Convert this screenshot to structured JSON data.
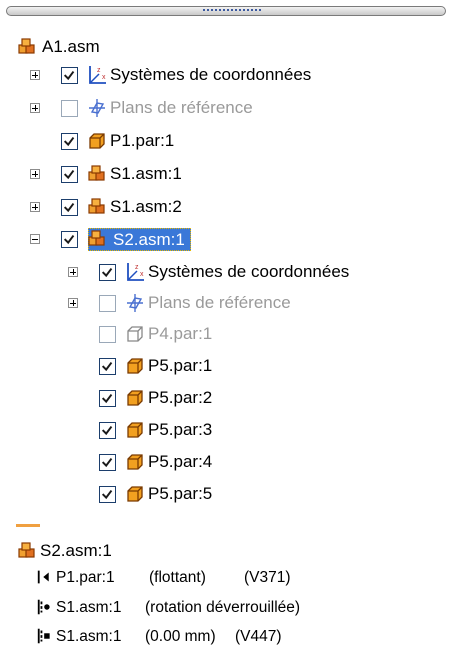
{
  "tree": {
    "root": {
      "label": "A1.asm",
      "icon": "assembly-icon"
    },
    "items": [
      {
        "label": "Systèmes de coordonnées",
        "expander": "plus",
        "checked": true,
        "icon": "coordinate-systems-icon"
      },
      {
        "label": "Plans de référence",
        "expander": "plus",
        "checked": false,
        "icon": "reference-planes-icon"
      },
      {
        "label": "P1.par:1",
        "expander": "none",
        "checked": true,
        "icon": "part-icon"
      },
      {
        "label": "S1.asm:1",
        "expander": "plus",
        "checked": true,
        "icon": "assembly-icon"
      },
      {
        "label": "S1.asm:2",
        "expander": "plus",
        "checked": true,
        "icon": "assembly-icon"
      },
      {
        "label": "S2.asm:1",
        "expander": "minus",
        "checked": true,
        "icon": "assembly-icon",
        "selected": true
      },
      {
        "label": "Systèmes de coordonnées",
        "expander": "plus",
        "checked": true,
        "icon": "coordinate-systems-icon"
      },
      {
        "label": "Plans de référence",
        "expander": "plus",
        "checked": false,
        "icon": "reference-planes-icon"
      },
      {
        "label": "P4.par:1",
        "expander": "none",
        "checked": false,
        "icon": "part-icon"
      },
      {
        "label": "P5.par:1",
        "expander": "none",
        "checked": true,
        "icon": "part-icon"
      },
      {
        "label": "P5.par:2",
        "expander": "none",
        "checked": true,
        "icon": "part-icon"
      },
      {
        "label": "P5.par:3",
        "expander": "none",
        "checked": true,
        "icon": "part-icon"
      },
      {
        "label": "P5.par:4",
        "expander": "none",
        "checked": true,
        "icon": "part-icon"
      },
      {
        "label": "P5.par:5",
        "expander": "none",
        "checked": true,
        "icon": "part-icon"
      }
    ]
  },
  "relations": {
    "title": "S2.asm:1",
    "items": [
      {
        "part": "P1.par:1",
        "detail": "(flottant)",
        "code": "(V371)",
        "icon": "float-relation-icon"
      },
      {
        "part": "S1.asm:1",
        "detail": "(rotation déverrouillée)",
        "code": "",
        "icon": "axial-align-relation-icon"
      },
      {
        "part": "S1.asm:1",
        "detail": "(0.00 mm)",
        "code": "(V447)",
        "icon": "mate-relation-icon"
      }
    ]
  },
  "colors": {
    "selection": "#3a78d8",
    "assembly": "#d2691e",
    "part": "#d88a00",
    "divider": "#f0a040"
  }
}
